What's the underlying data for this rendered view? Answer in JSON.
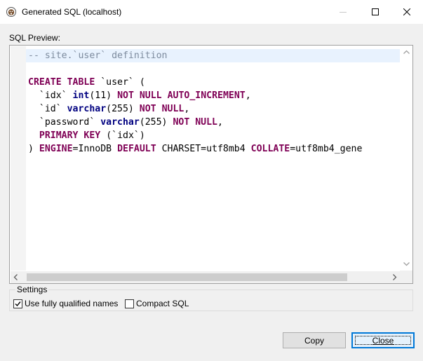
{
  "window": {
    "title": "Generated SQL (localhost)",
    "icon": "dbeaver-beaver-icon"
  },
  "preview_label": "SQL Preview:",
  "code_lines": [
    [
      {
        "t": "comment",
        "v": "-- site.`user` definition"
      }
    ],
    [],
    [
      {
        "t": "kw",
        "v": "CREATE"
      },
      {
        "t": "txt",
        "v": " "
      },
      {
        "t": "kw",
        "v": "TABLE"
      },
      {
        "t": "txt",
        "v": " `user` ("
      }
    ],
    [
      {
        "t": "txt",
        "v": "  `idx` "
      },
      {
        "t": "type",
        "v": "int"
      },
      {
        "t": "txt",
        "v": "(11) "
      },
      {
        "t": "kw",
        "v": "NOT"
      },
      {
        "t": "txt",
        "v": " "
      },
      {
        "t": "kw",
        "v": "NULL"
      },
      {
        "t": "txt",
        "v": " "
      },
      {
        "t": "kw",
        "v": "AUTO_INCREMENT"
      },
      {
        "t": "txt",
        "v": ","
      }
    ],
    [
      {
        "t": "txt",
        "v": "  `id` "
      },
      {
        "t": "type",
        "v": "varchar"
      },
      {
        "t": "txt",
        "v": "(255) "
      },
      {
        "t": "kw",
        "v": "NOT"
      },
      {
        "t": "txt",
        "v": " "
      },
      {
        "t": "kw",
        "v": "NULL"
      },
      {
        "t": "txt",
        "v": ","
      }
    ],
    [
      {
        "t": "txt",
        "v": "  `password` "
      },
      {
        "t": "type",
        "v": "varchar"
      },
      {
        "t": "txt",
        "v": "(255) "
      },
      {
        "t": "kw",
        "v": "NOT"
      },
      {
        "t": "txt",
        "v": " "
      },
      {
        "t": "kw",
        "v": "NULL"
      },
      {
        "t": "txt",
        "v": ","
      }
    ],
    [
      {
        "t": "txt",
        "v": "  "
      },
      {
        "t": "kw",
        "v": "PRIMARY"
      },
      {
        "t": "txt",
        "v": " "
      },
      {
        "t": "kw",
        "v": "KEY"
      },
      {
        "t": "txt",
        "v": " (`idx`)"
      }
    ],
    [
      {
        "t": "txt",
        "v": ") "
      },
      {
        "t": "kw",
        "v": "ENGINE"
      },
      {
        "t": "txt",
        "v": "=InnoDB "
      },
      {
        "t": "kw",
        "v": "DEFAULT"
      },
      {
        "t": "txt",
        "v": " CHARSET="
      },
      {
        "t": "txt",
        "v": "utf8mb4 "
      },
      {
        "t": "kw",
        "v": "COLLATE"
      },
      {
        "t": "txt",
        "v": "=utf8mb4_gene"
      }
    ]
  ],
  "settings": {
    "legend": "Settings",
    "fully_qualified": {
      "label": "Use fully qualified names",
      "checked": true
    },
    "compact": {
      "label": "Compact SQL",
      "checked": false
    }
  },
  "buttons": {
    "copy": "Copy",
    "close": "Close"
  },
  "colors": {
    "keyword": "#7f0055",
    "type": "#000080",
    "comment": "#7d8b9e",
    "accent": "#0078d7"
  }
}
